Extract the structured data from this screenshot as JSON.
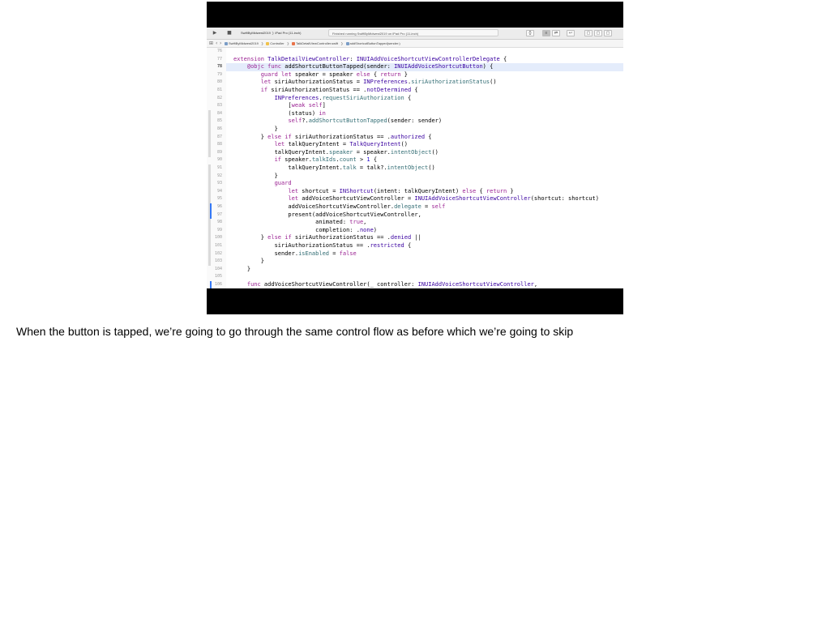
{
  "toolbar": {
    "run_icon": "play-icon",
    "stop_icon": "stop-icon",
    "scheme": "SwiftByMidwest2019",
    "device": "iPad Pro (11-inch)",
    "status": "Finished running SwiftByMidwest2019 on iPad Pro (11-inch)",
    "right_buttons": [
      "{ }",
      "≡",
      "⇄",
      "↩",
      "▢",
      "▢",
      "▢"
    ]
  },
  "jumpbar": {
    "crumbs": [
      "SwiftByMidwest2019",
      "Controller",
      "TalkDetailViewController.swift",
      "addShortcutButtonTapped(sender:)"
    ]
  },
  "editor": {
    "current_line": "78",
    "lines": [
      {
        "n": "76",
        "t": ""
      },
      {
        "n": "77",
        "t": "extension TalkDetailViewController: INUIAddVoiceShortcutViewControllerDelegate {"
      },
      {
        "n": "78",
        "t": "    @objc func addShortcutButtonTapped(sender: INUIAddVoiceShortcutButton) {"
      },
      {
        "n": "79",
        "t": "        guard let speaker = speaker else { return }"
      },
      {
        "n": "80",
        "t": "        let siriAuthorizationStatus = INPreferences.siriAuthorizationStatus()"
      },
      {
        "n": "81",
        "t": "        if siriAuthorizationStatus == .notDetermined {"
      },
      {
        "n": "82",
        "t": "            INPreferences.requestSiriAuthorization {"
      },
      {
        "n": "83",
        "t": "                [weak self]"
      },
      {
        "n": "84",
        "t": "                (status) in"
      },
      {
        "n": "85",
        "t": "                self?.addShortcutButtonTapped(sender: sender)"
      },
      {
        "n": "86",
        "t": "            }"
      },
      {
        "n": "87",
        "t": "        } else if siriAuthorizationStatus == .authorized {"
      },
      {
        "n": "88",
        "t": "            let talkQueryIntent = TalkQueryIntent()"
      },
      {
        "n": "89",
        "t": "            talkQueryIntent.speaker = speaker.intentObject()"
      },
      {
        "n": "90",
        "t": "            if speaker.talkIds.count > 1 {"
      },
      {
        "n": "91",
        "t": "                talkQueryIntent.talk = talk?.intentObject()"
      },
      {
        "n": "92",
        "t": "            }"
      },
      {
        "n": "93",
        "t": "            guard"
      },
      {
        "n": "94",
        "t": "                let shortcut = INShortcut(intent: talkQueryIntent) else { return }"
      },
      {
        "n": "95",
        "t": "                let addVoiceShortcutViewController = INUIAddVoiceShortcutViewController(shortcut: shortcut)"
      },
      {
        "n": "96",
        "t": "                addVoiceShortcutViewController.delegate = self"
      },
      {
        "n": "97",
        "t": "                present(addVoiceShortcutViewController,"
      },
      {
        "n": "98",
        "t": "                        animated: true,"
      },
      {
        "n": "99",
        "t": "                        completion: .none)"
      },
      {
        "n": "100",
        "t": "        } else if siriAuthorizationStatus == .denied ||"
      },
      {
        "n": "101",
        "t": "            siriAuthorizationStatus == .restricted {"
      },
      {
        "n": "102",
        "t": "            sender.isEnabled = false"
      },
      {
        "n": "103",
        "t": "        }"
      },
      {
        "n": "104",
        "t": "    }"
      },
      {
        "n": "105",
        "t": ""
      },
      {
        "n": "106",
        "t": "    func addVoiceShortcutViewController(_ controller: INUIAddVoiceShortcutViewController,"
      }
    ]
  },
  "caption": "When the button is tapped, we’re going to go through the same control flow as before which we’re going to skip",
  "colors": {
    "keyword": "#9b2393",
    "type": "#3900a0",
    "function": "#326d74",
    "literal": "#1c00cf",
    "highlight": "#e4ecfb",
    "frame": "#000000"
  }
}
